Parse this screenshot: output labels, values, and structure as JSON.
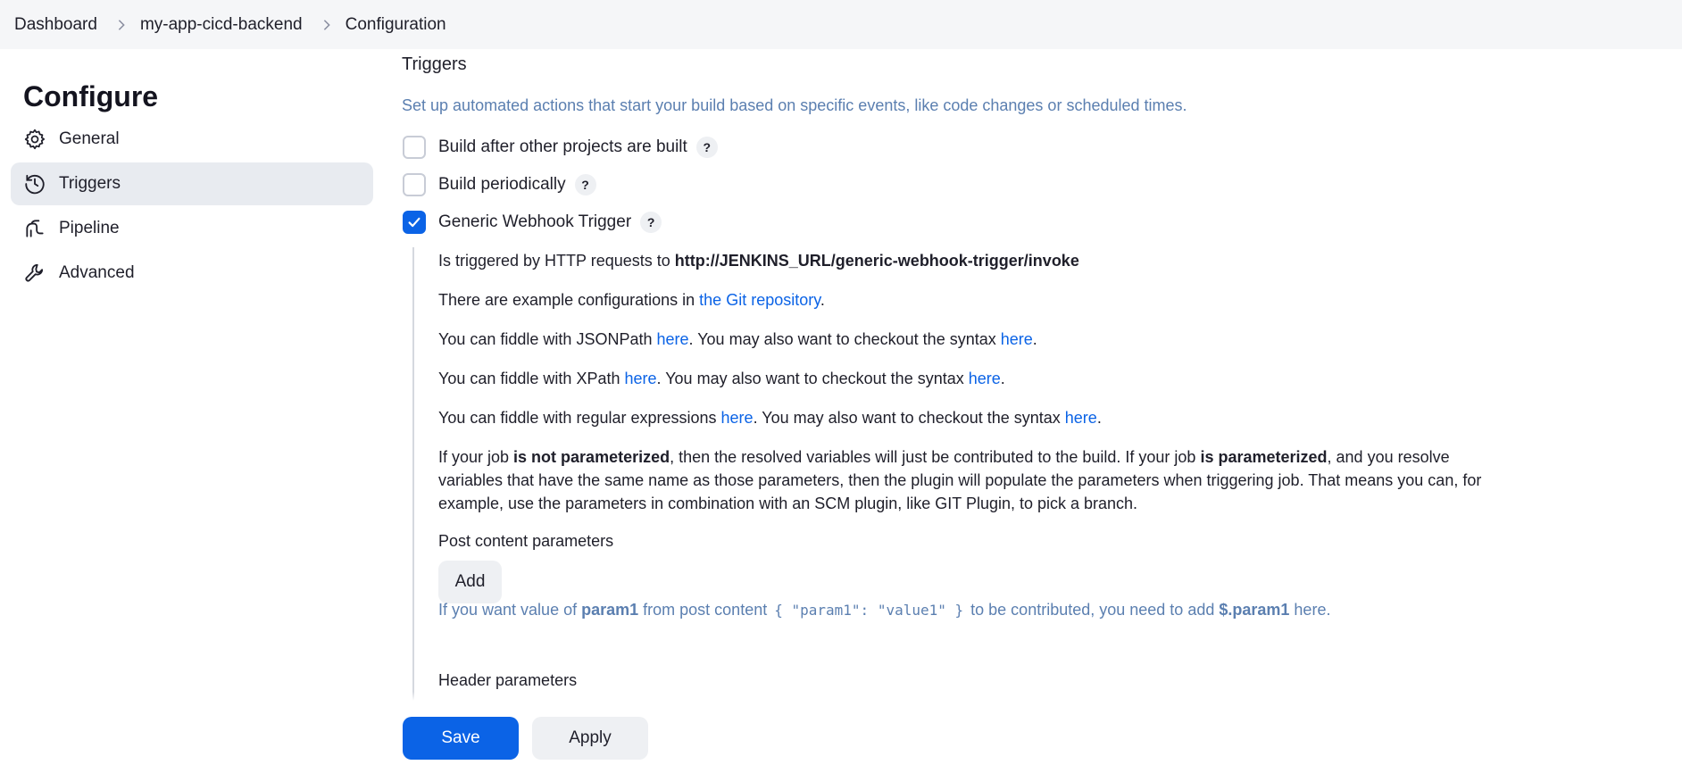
{
  "breadcrumb": {
    "items": [
      "Dashboard",
      "my-app-cicd-backend",
      "Configuration"
    ]
  },
  "sidebar": {
    "title": "Configure",
    "items": [
      {
        "label": "General",
        "icon": "gear-icon"
      },
      {
        "label": "Triggers",
        "icon": "clock-icon",
        "active": true
      },
      {
        "label": "Pipeline",
        "icon": "pipeline-icon"
      },
      {
        "label": "Advanced",
        "icon": "wrench-icon"
      }
    ]
  },
  "triggers": {
    "title": "Triggers",
    "description": "Set up automated actions that start your build based on specific events, like code changes or scheduled times.",
    "options": [
      {
        "label": "Build after other projects are built",
        "checked": false
      },
      {
        "label": "Build periodically",
        "checked": false
      },
      {
        "label": "Generic Webhook Trigger",
        "checked": true
      }
    ],
    "help_label": "?"
  },
  "webhook": {
    "invoke_prefix": "Is triggered by HTTP requests to ",
    "invoke_url": "http://JENKINS_URL/generic-webhook-trigger/invoke",
    "examples_prefix": "There are example configurations in ",
    "examples_link": "the Git repository",
    "examples_suffix": ".",
    "jsonpath_prefix": "You can fiddle with JSONPath ",
    "xpath_prefix": "You can fiddle with XPath ",
    "regex_prefix": "You can fiddle with regular expressions ",
    "here": "here",
    "syntax_middle": ". You may also want to checkout the syntax ",
    "period": ".",
    "param_p1": "If your job ",
    "param_b1": "is not parameterized",
    "param_p2": ", then the resolved variables will just be contributed to the build. If your job ",
    "param_b2": "is parameterized",
    "param_p3": ", and you resolve variables that have the same name as those parameters, then the plugin will populate the parameters when triggering job. That means you can, for example, use the parameters in combination with an SCM plugin, like GIT Plugin, to pick a branch.",
    "post_label": "Post content parameters",
    "add_label": "Add",
    "hint_p1": "If you want value of ",
    "hint_b1": "param1",
    "hint_p2": " from post content ",
    "hint_code": "{ \"param1\": \"value1\" }",
    "hint_p3": " to be contributed, you need to add ",
    "hint_b2": "$.param1",
    "hint_p4": " here.",
    "header_label": "Header parameters"
  },
  "footer": {
    "save_label": "Save",
    "apply_label": "Apply"
  },
  "colors": {
    "accent": "#0b63e6",
    "hint": "#5b7fb0",
    "active_bg": "#e8ebf0"
  }
}
